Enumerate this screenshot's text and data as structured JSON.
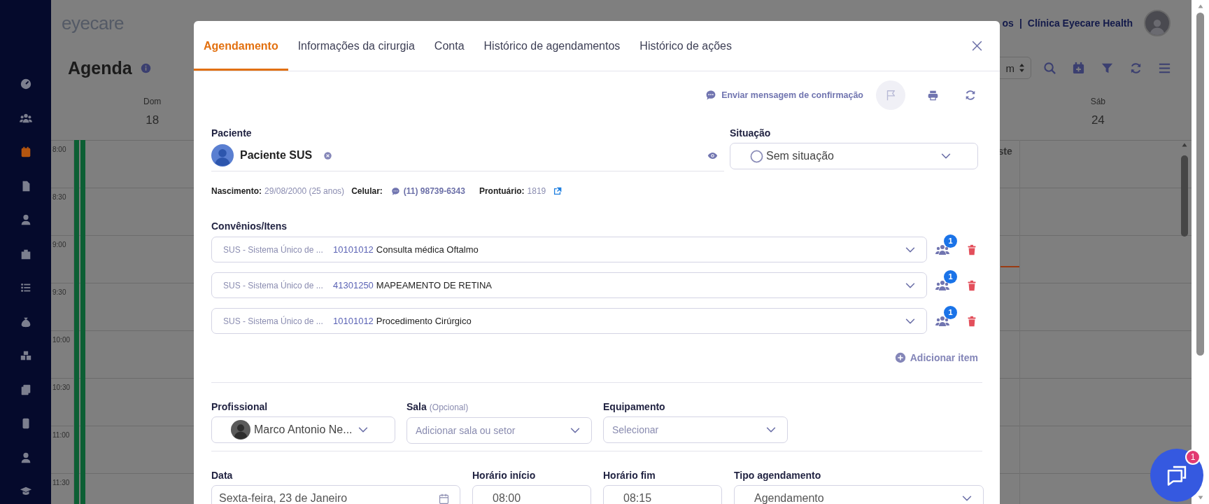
{
  "app": {
    "logo": "eyecare",
    "sidebar": {
      "items": [
        {
          "selected": false
        },
        {
          "selected": false
        },
        {
          "selected": true
        },
        {
          "selected": false
        },
        {
          "selected": false
        },
        {
          "selected": false
        },
        {
          "selected": false
        },
        {
          "selected": false
        },
        {
          "selected": false
        },
        {
          "selected": false
        },
        {
          "selected": false
        },
        {
          "selected": false
        },
        {
          "selected": false
        }
      ]
    },
    "header": {
      "user_partial": "os",
      "separator": "|",
      "clinic": "Clínica Eyecare Health"
    },
    "page_title": "Agenda",
    "view_select_partial": "m",
    "calendar": {
      "days": [
        {
          "name": "Dom",
          "date": "18"
        },
        {
          "name": "Sáb",
          "date": "24"
        }
      ],
      "times": [
        "8:00",
        "8:30",
        "9:00",
        "9:30",
        "10:00",
        "10:30",
        "11:00",
        "11:30"
      ],
      "event_partial": "ste"
    }
  },
  "modal": {
    "tabs": [
      {
        "label": "Agendamento",
        "selected": true
      },
      {
        "label": "Informações da cirurgia",
        "selected": false
      },
      {
        "label": "Conta",
        "selected": false
      },
      {
        "label": "Histórico de agendamentos",
        "selected": false
      },
      {
        "label": "Histórico de ações",
        "selected": false
      }
    ],
    "send_confirmation": "Enviar mensagem de confirmação",
    "patient": {
      "label": "Paciente",
      "name": "Paciente SUS",
      "birth_label": "Nascimento:",
      "birth": "29/08/2000 (25 anos)",
      "phone_label": "Celular:",
      "phone": "(11) 98739-6343",
      "record_label": "Prontuário:",
      "record": "1819"
    },
    "status": {
      "label": "Situação",
      "value": "Sem situação"
    },
    "items": {
      "label": "Convênios/Itens",
      "rows": [
        {
          "insurance": "SUS - Sistema Único de ...",
          "code": "10101012",
          "name": "Consulta médica Oftalmo",
          "badge": "1"
        },
        {
          "insurance": "SUS - Sistema Único de ...",
          "code": "41301250",
          "name": "MAPEAMENTO DE RETINA",
          "badge": "1"
        },
        {
          "insurance": "SUS - Sistema Único de ...",
          "code": "10101012",
          "name": "Procedimento Cirúrgico",
          "badge": "1"
        }
      ],
      "add": "Adicionar item"
    },
    "professional": {
      "label": "Profissional",
      "value": "Marco Antonio Ne..."
    },
    "room": {
      "label": "Sala",
      "hint": "(Opcional)",
      "placeholder": "Adicionar sala ou setor"
    },
    "equipment": {
      "label": "Equipamento",
      "placeholder": "Selecionar"
    },
    "date": {
      "label": "Data",
      "value": "Sexta-feira, 23 de Janeiro"
    },
    "start": {
      "label": "Horário início",
      "value": "08:00"
    },
    "end": {
      "label": "Horário fim",
      "value": "08:15"
    },
    "type": {
      "label": "Tipo agendamento",
      "value": "Agendamento"
    }
  },
  "chat": {
    "badge": "1"
  }
}
